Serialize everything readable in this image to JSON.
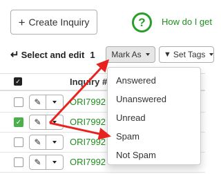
{
  "toolbar": {
    "create_label": "Create Inquiry",
    "help_symbol": "?",
    "help_link": "How do I get"
  },
  "selection": {
    "label": "Select and edit",
    "count": "1",
    "mark_as_label": "Mark As",
    "set_tags_label": "Set Tags"
  },
  "table": {
    "header_label": "Inquiry #",
    "rows": [
      {
        "id": "ORI7992",
        "checked": false
      },
      {
        "id": "ORI7992",
        "checked": true
      },
      {
        "id": "ORI7992",
        "checked": false
      },
      {
        "id": "ORI7992",
        "checked": false
      }
    ]
  },
  "dropdown": {
    "items": [
      "Answered",
      "Unanswered",
      "Unread",
      "Spam",
      "Not Spam"
    ]
  },
  "colors": {
    "link_green": "#1e8e1e",
    "check_green": "#4cae4c",
    "arrow_red": "#e8231f"
  }
}
